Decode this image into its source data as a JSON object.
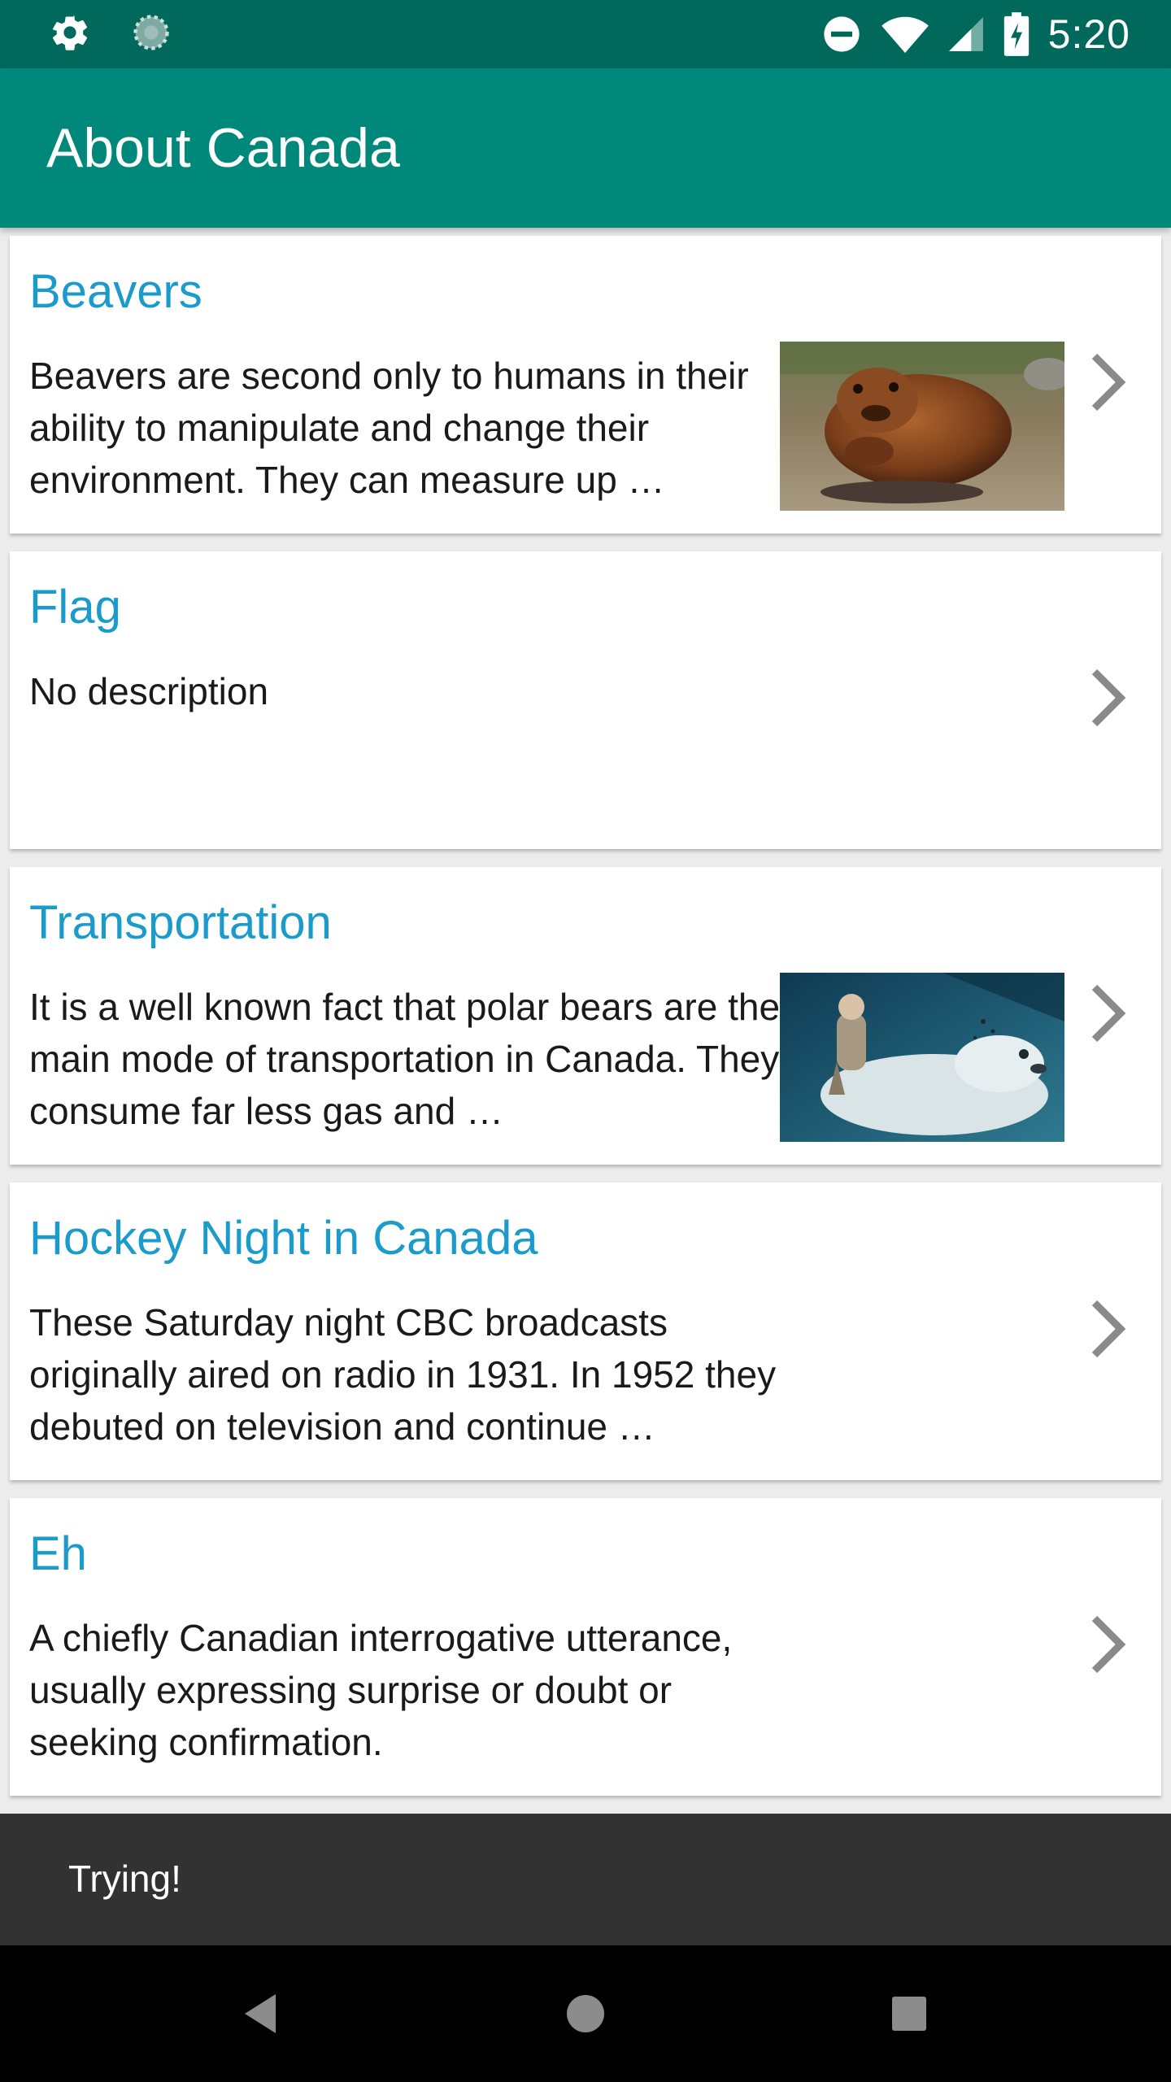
{
  "status_bar": {
    "time": "5:20",
    "icons": [
      "gear-icon",
      "sync-icon",
      "do-not-disturb-icon",
      "wifi-icon",
      "cell-signal-icon",
      "battery-charging-icon"
    ]
  },
  "app_bar": {
    "title": "About Canada"
  },
  "cards": [
    {
      "title": "Beavers",
      "description": "Beavers are second only to humans in their ability to manipulate and change their environment. They can measure up …",
      "has_image": true,
      "image_subject": "beaver"
    },
    {
      "title": "Flag",
      "description": "No description",
      "has_image": false
    },
    {
      "title": "Transportation",
      "description": "It is a well known fact that polar bears are the main mode of transportation in Canada. They consume far less gas and …",
      "has_image": true,
      "image_subject": "polar-bear-rider"
    },
    {
      "title": "Hockey Night in Canada",
      "description": "These Saturday night CBC broadcasts originally aired on radio in 1931. In 1952 they debuted on television and continue …",
      "has_image": false
    },
    {
      "title": "Eh",
      "description": "A chiefly Canadian interrogative utterance, usually expressing surprise or doubt or seeking confirmation.",
      "has_image": false
    }
  ],
  "snackbar": {
    "message": "Trying!"
  },
  "nav_bar": {
    "buttons": [
      "back-icon",
      "home-icon",
      "recents-icon"
    ]
  },
  "colors": {
    "status_bar": "#00695c",
    "app_bar": "#00897b",
    "card_title": "#1a9bcb",
    "snackbar": "#323232"
  }
}
